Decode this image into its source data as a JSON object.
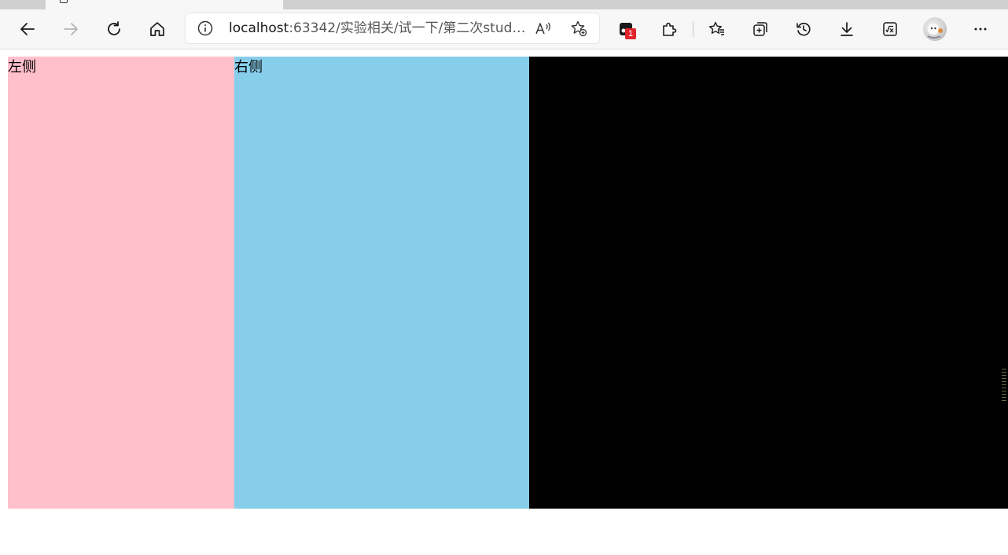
{
  "browser": {
    "address_bar": {
      "url_host": "localhost",
      "url_rest": ":63342/实验相关/试一下/第二次study..."
    },
    "extension_badge_count": "1",
    "icons": {
      "back": "back-arrow-icon",
      "forward": "forward-arrow-icon",
      "refresh": "refresh-icon",
      "home": "home-icon",
      "site_info": "info-icon",
      "read_aloud": "read-aloud-icon",
      "add_favorite": "add-favorite-icon",
      "extension": "extension-icon",
      "extensions": "puzzle-icon",
      "favorites": "favorites-icon",
      "collections": "collections-icon",
      "history": "history-icon",
      "downloads": "download-icon",
      "math_solver": "math-solver-icon",
      "profile": "avatar",
      "more": "more-icon"
    }
  },
  "page": {
    "left_panel": {
      "label": "左侧",
      "color": "#ffc0cb"
    },
    "right_panel": {
      "label": "右侧",
      "color": "#87ceeb"
    },
    "third_panel": {
      "color": "#000000"
    }
  }
}
